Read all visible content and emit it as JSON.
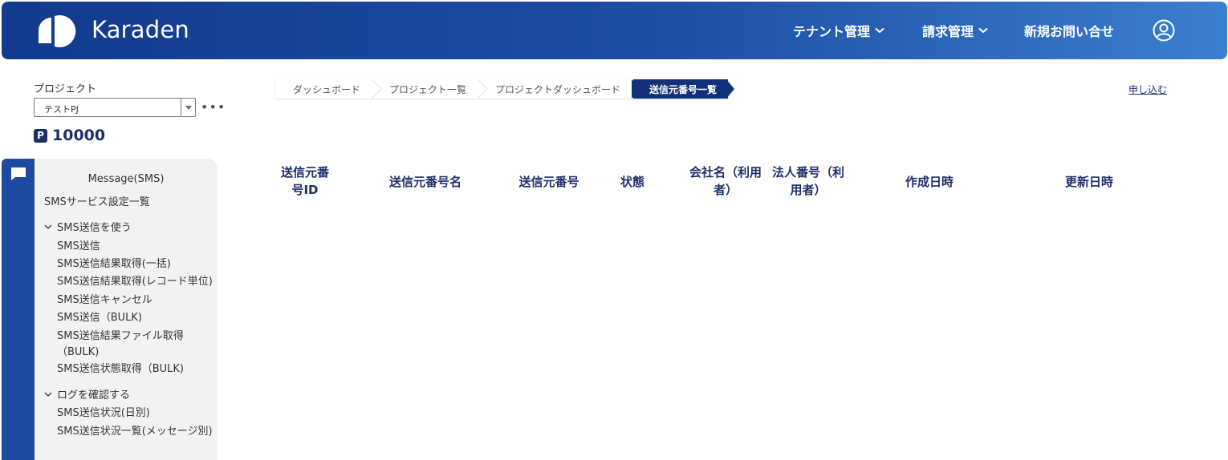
{
  "header": {
    "logo_text": "Karaden",
    "nav": {
      "tenant_label": "テナント管理",
      "billing_label": "請求管理",
      "contact_label": "新規お問い合せ"
    }
  },
  "project": {
    "label": "プロジェクト",
    "selected": "テストPJ",
    "points_badge": "P",
    "points": "10000"
  },
  "sidebar": {
    "title": "Message(SMS)",
    "settings_link": "SMSサービス設定一覧",
    "groups": [
      {
        "label": "SMS送信を使う",
        "items": [
          "SMS送信",
          "SMS送信結果取得(一括)",
          "SMS送信結果取得(レコード単位)",
          "SMS送信キャンセル",
          "SMS送信（BULK)",
          "SMS送信結果ファイル取得",
          "（BULK)",
          "SMS送信状態取得（BULK)"
        ]
      },
      {
        "label": "ログを確認する",
        "items": [
          "SMS送信状況(日別)",
          "SMS送信状況一覧(メッセージ別)"
        ]
      }
    ]
  },
  "breadcrumb": [
    "ダッシュボード",
    "プロジェクト一覧",
    "プロジェクトダッシュボード",
    "送信元番号一覧"
  ],
  "apply_link": "申し込む",
  "table": {
    "columns": [
      [
        "送信元番",
        "号ID"
      ],
      [
        "送信元番号名"
      ],
      [
        "送信元番号"
      ],
      [
        "状態"
      ],
      [
        "会社名（利用",
        "者）"
      ],
      [
        "法人番号（利",
        "用者）"
      ],
      [
        "作成日時"
      ],
      [
        "更新日時"
      ]
    ]
  }
}
